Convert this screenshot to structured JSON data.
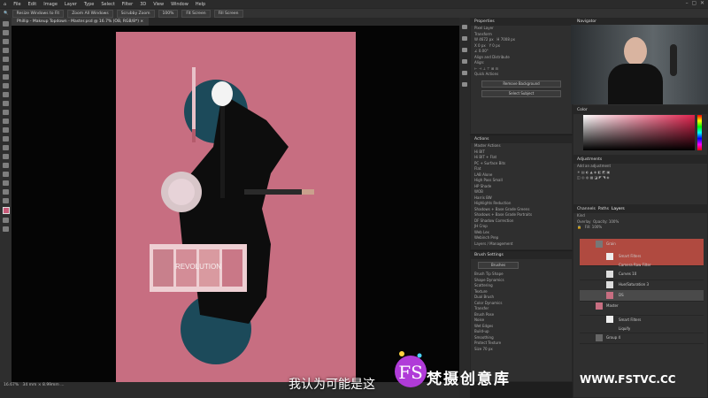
{
  "menu": {
    "items": [
      "File",
      "Edit",
      "Image",
      "Layer",
      "Type",
      "Select",
      "Filter",
      "3D",
      "View",
      "Window",
      "Help"
    ]
  },
  "options_bar": {
    "buttons": [
      "Resize Windows to Fit",
      "Zoom All Windows",
      "Scrubby Zoom",
      "100%",
      "Fit Screen",
      "Fill Screen"
    ]
  },
  "document": {
    "tab": "Phillip - Makeup Topdown - Master.psd @ 16.7% (OB, RGB/8*) ×"
  },
  "status": {
    "zoom": "16.67%",
    "info": "34 mm × 8.99mm ..."
  },
  "properties": {
    "title": "Properties",
    "kind": "Pixel Layer",
    "transform_label": "Transform",
    "w": "4672 px",
    "h": "7008 px",
    "x": "0 px",
    "y": "0 px",
    "angle": "0.00°",
    "align_label": "Align and Distribute",
    "align_sub": "Align:",
    "quick_label": "Quick Actions",
    "quick_buttons": [
      "Remove Background",
      "Select Subject"
    ]
  },
  "actions": {
    "title": "Actions",
    "items": [
      "Master Actions",
      "Hi BIT",
      "Hi BIT + Flat",
      "PC + Surface Bits",
      "Flat",
      "LAB Alone",
      "High Pass Small",
      "HP Shade",
      "WOB",
      "Harris BW",
      "Highlights Reduction",
      "Shadows + Base Grade Greens",
      "Shadows + Base Grade Portraits",
      "DF Shadow Correction",
      "JH Crop",
      "Web Lex",
      "Webinch Prep",
      "Layers / Management"
    ]
  },
  "brush": {
    "title": "Brush Settings",
    "button": "Brushes",
    "options": [
      "Brush Tip Shape",
      "Shape Dynamics",
      "Scattering",
      "Texture",
      "Dual Brush",
      "Color Dynamics",
      "Transfer",
      "Brush Pose",
      "Noise",
      "Wet Edges",
      "Build-up",
      "Smoothing",
      "Protect Texture"
    ],
    "size": "Size",
    "size_value": "70 px"
  },
  "navigator": {
    "title": "Navigator"
  },
  "color": {
    "title": "Color",
    "fg": "#c75a78",
    "bg": "#000000"
  },
  "adjustments": {
    "title": "Adjustments",
    "sub": "Add an adjustment"
  },
  "layers": {
    "tabs": [
      "Channels",
      "Paths",
      "Layers"
    ],
    "kind": "Kind",
    "blend": "Overlay",
    "opacity_label": "Opacity:",
    "opacity": "100%",
    "fill_label": "Fill:",
    "fill": "100%",
    "rows": [
      {
        "name": "Grain",
        "thumb": "#777"
      },
      {
        "name": "Smart Filters",
        "thumb": "#eee"
      },
      {
        "name": "Camera Raw Filter",
        "thumb": "#eee"
      },
      {
        "name": "Curves 10",
        "thumb": "#ddd"
      },
      {
        "name": "Hue/Saturation 3",
        "thumb": "#ddd"
      },
      {
        "name": "DS",
        "thumb": "#c76e81"
      },
      {
        "name": "Master",
        "thumb": "#c76e81"
      },
      {
        "name": "Smart Filters",
        "thumb": "#eee"
      },
      {
        "name": "Liquify",
        "thumb": "#eee"
      },
      {
        "name": "Group 4",
        "thumb": "#666"
      }
    ]
  },
  "product": {
    "name": "REVOLUTION",
    "mascara": "REVOLUTION"
  },
  "overlay": {
    "subtitle": "我认为可能是这",
    "brand": "梵摄创意库",
    "site": "WWW.FSTVC.CC",
    "logo": "FS"
  }
}
